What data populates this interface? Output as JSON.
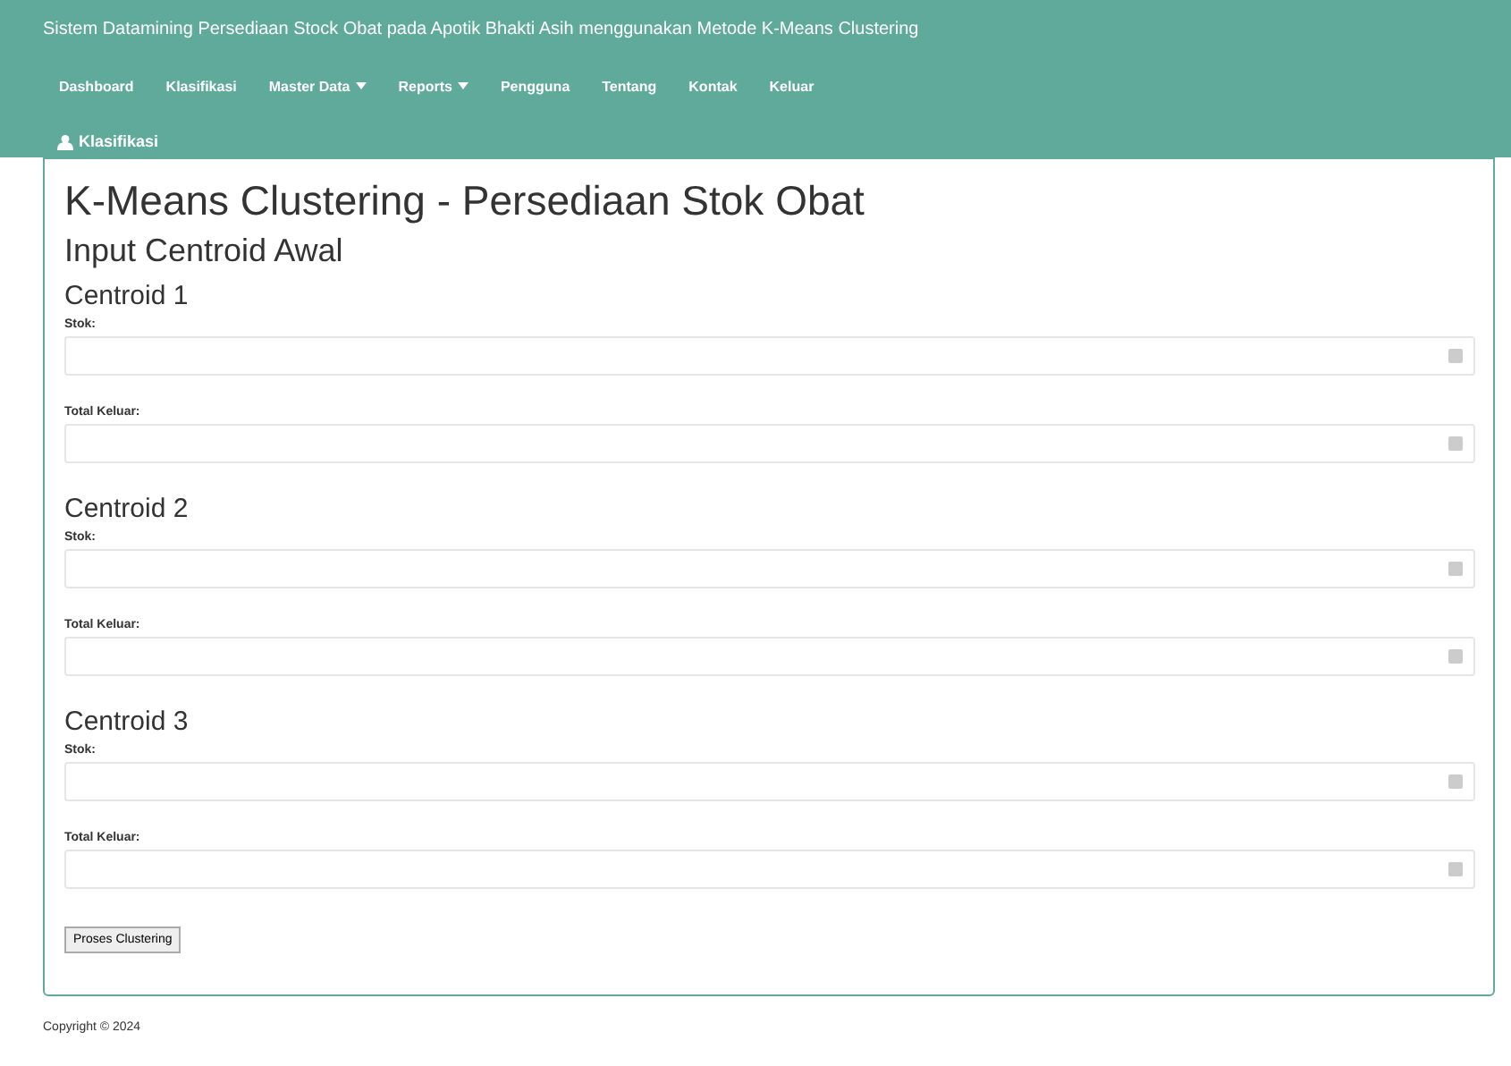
{
  "header": {
    "title": "Sistem Datamining Persediaan Stock Obat pada Apotik Bhakti Asih menggunakan Metode K-Means Clustering"
  },
  "nav": [
    {
      "label": "Dashboard",
      "dropdown": false
    },
    {
      "label": "Klasifikasi",
      "dropdown": false
    },
    {
      "label": "Master Data",
      "dropdown": true
    },
    {
      "label": "Reports",
      "dropdown": true
    },
    {
      "label": "Pengguna",
      "dropdown": false
    },
    {
      "label": "Tentang",
      "dropdown": false
    },
    {
      "label": "Kontak",
      "dropdown": false
    },
    {
      "label": "Keluar",
      "dropdown": false
    }
  ],
  "panel": {
    "heading": "Klasifikasi",
    "title": "K-Means Clustering - Persediaan Stok Obat",
    "subtitle": "Input Centroid Awal",
    "centroids": [
      {
        "name": "Centroid 1",
        "fields": [
          {
            "label": "Stok:"
          },
          {
            "label": "Total Keluar:"
          }
        ]
      },
      {
        "name": "Centroid 2",
        "fields": [
          {
            "label": "Stok:"
          },
          {
            "label": "Total Keluar:"
          }
        ]
      },
      {
        "name": "Centroid 3",
        "fields": [
          {
            "label": "Stok:"
          },
          {
            "label": "Total Keluar:"
          }
        ]
      }
    ],
    "button": "Proses Clustering"
  },
  "footer": "Copyright © 2024"
}
